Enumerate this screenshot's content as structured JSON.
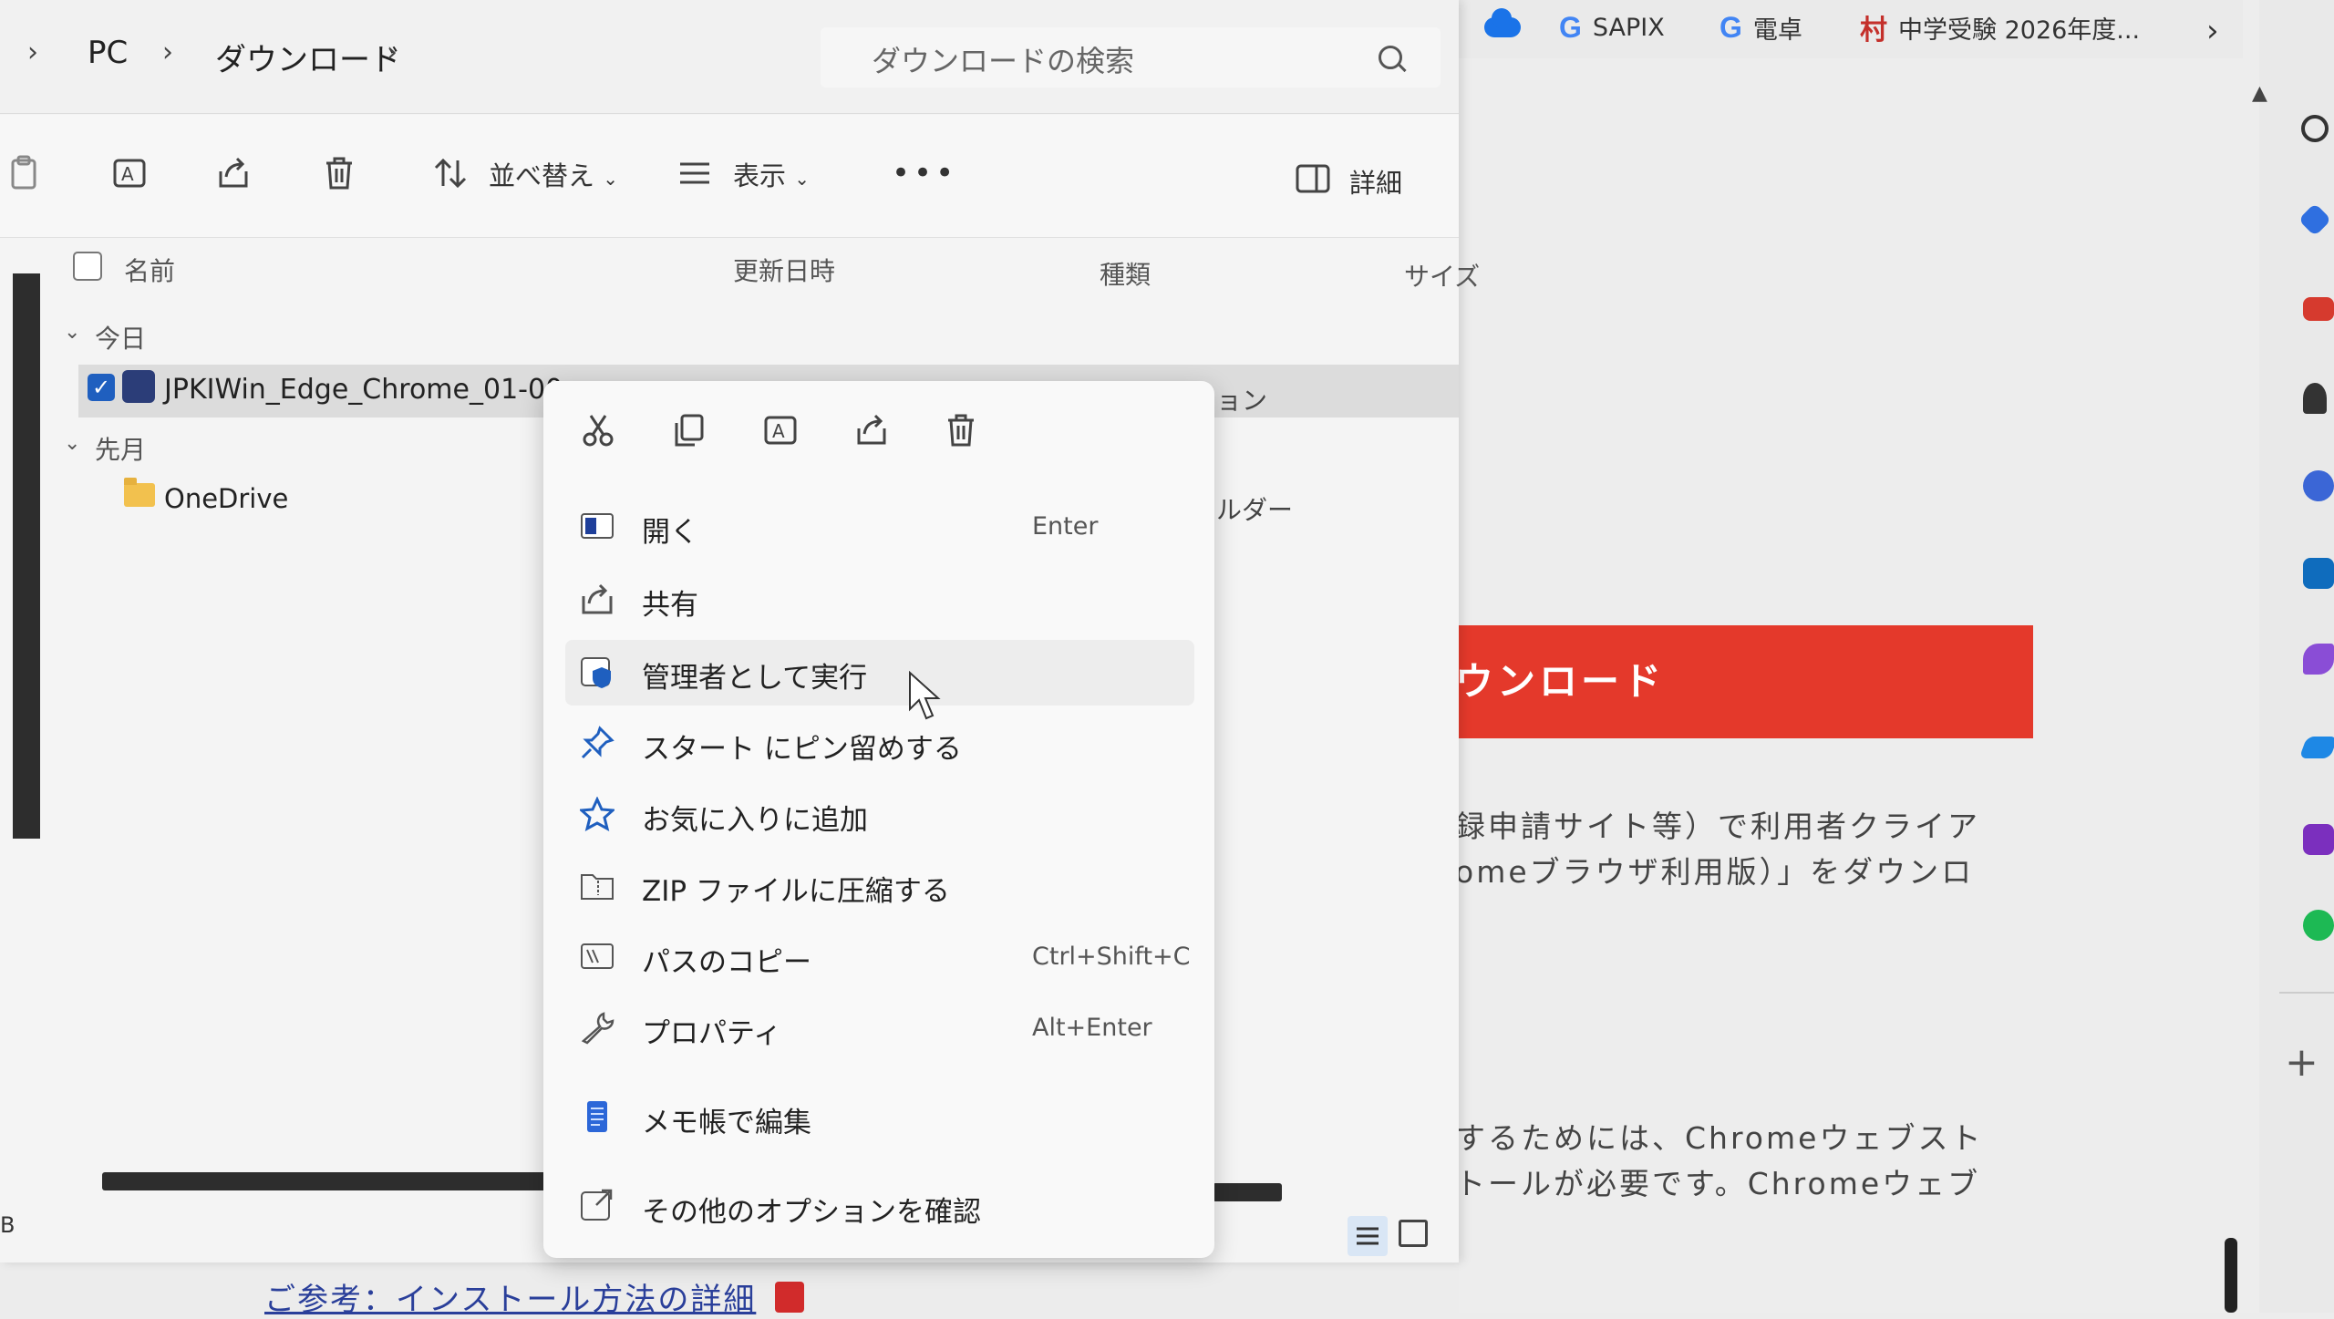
{
  "browser": {
    "bookmarks": [
      {
        "label": "SAPIX",
        "icon": "google-icon"
      },
      {
        "label": "電卓",
        "icon": "google-icon"
      },
      {
        "label": "中学受験 2026年度...",
        "icon": "bookmark-icon"
      }
    ],
    "banner_text": "ウンロード",
    "paragraph1": [
      "録申請サイト等）で利用者クライア",
      "omeブラウザ利用版）」をダウンロ"
    ],
    "paragraph2": [
      "するためには、Chromeウェブスト",
      "トールが必要です。Chromeウェブ"
    ],
    "bottom_link": "ご参考：インストール方法の詳細"
  },
  "explorer": {
    "breadcrumb": [
      "PC",
      "ダウンロード"
    ],
    "search_placeholder": "ダウンロードの検索",
    "toolbar": {
      "sort_label": "並べ替え",
      "view_label": "表示",
      "more_label": "•••",
      "details_label": "詳細"
    },
    "columns": {
      "name": "名前",
      "modified": "更新日時",
      "type": "種類",
      "size": "サイズ"
    },
    "groups": [
      {
        "label": "今日",
        "items": [
          {
            "name": "JPKIWin_Edge_Chrome_01-00",
            "type": "ョン",
            "selected": true
          }
        ]
      },
      {
        "label": "先月",
        "items": [
          {
            "name": "OneDrive",
            "type": "ルダー",
            "selected": false
          }
        ]
      }
    ],
    "status_left": "B"
  },
  "context_menu": {
    "items": [
      {
        "label": "開く",
        "shortcut": "Enter",
        "icon": "open-icon"
      },
      {
        "label": "共有",
        "shortcut": "",
        "icon": "share-icon"
      },
      {
        "label": "管理者として実行",
        "shortcut": "",
        "icon": "shield-icon",
        "hovered": true
      },
      {
        "label": "スタート にピン留めする",
        "shortcut": "",
        "icon": "pin-icon"
      },
      {
        "label": "お気に入りに追加",
        "shortcut": "",
        "icon": "star-icon"
      },
      {
        "label": "ZIP ファイルに圧縮する",
        "shortcut": "",
        "icon": "zip-icon"
      },
      {
        "label": "パスのコピー",
        "shortcut": "Ctrl+Shift+C",
        "icon": "copy-path-icon"
      },
      {
        "label": "プロパティ",
        "shortcut": "Alt+Enter",
        "icon": "wrench-icon"
      },
      {
        "label": "メモ帳で編集",
        "shortcut": "",
        "icon": "notepad-icon"
      },
      {
        "label": "その他のオプションを確認",
        "shortcut": "",
        "icon": "more-options-icon"
      }
    ]
  },
  "colors": {
    "accent": "#1f5fbf",
    "banner": "#e4392b",
    "link": "#2a3f9a"
  }
}
